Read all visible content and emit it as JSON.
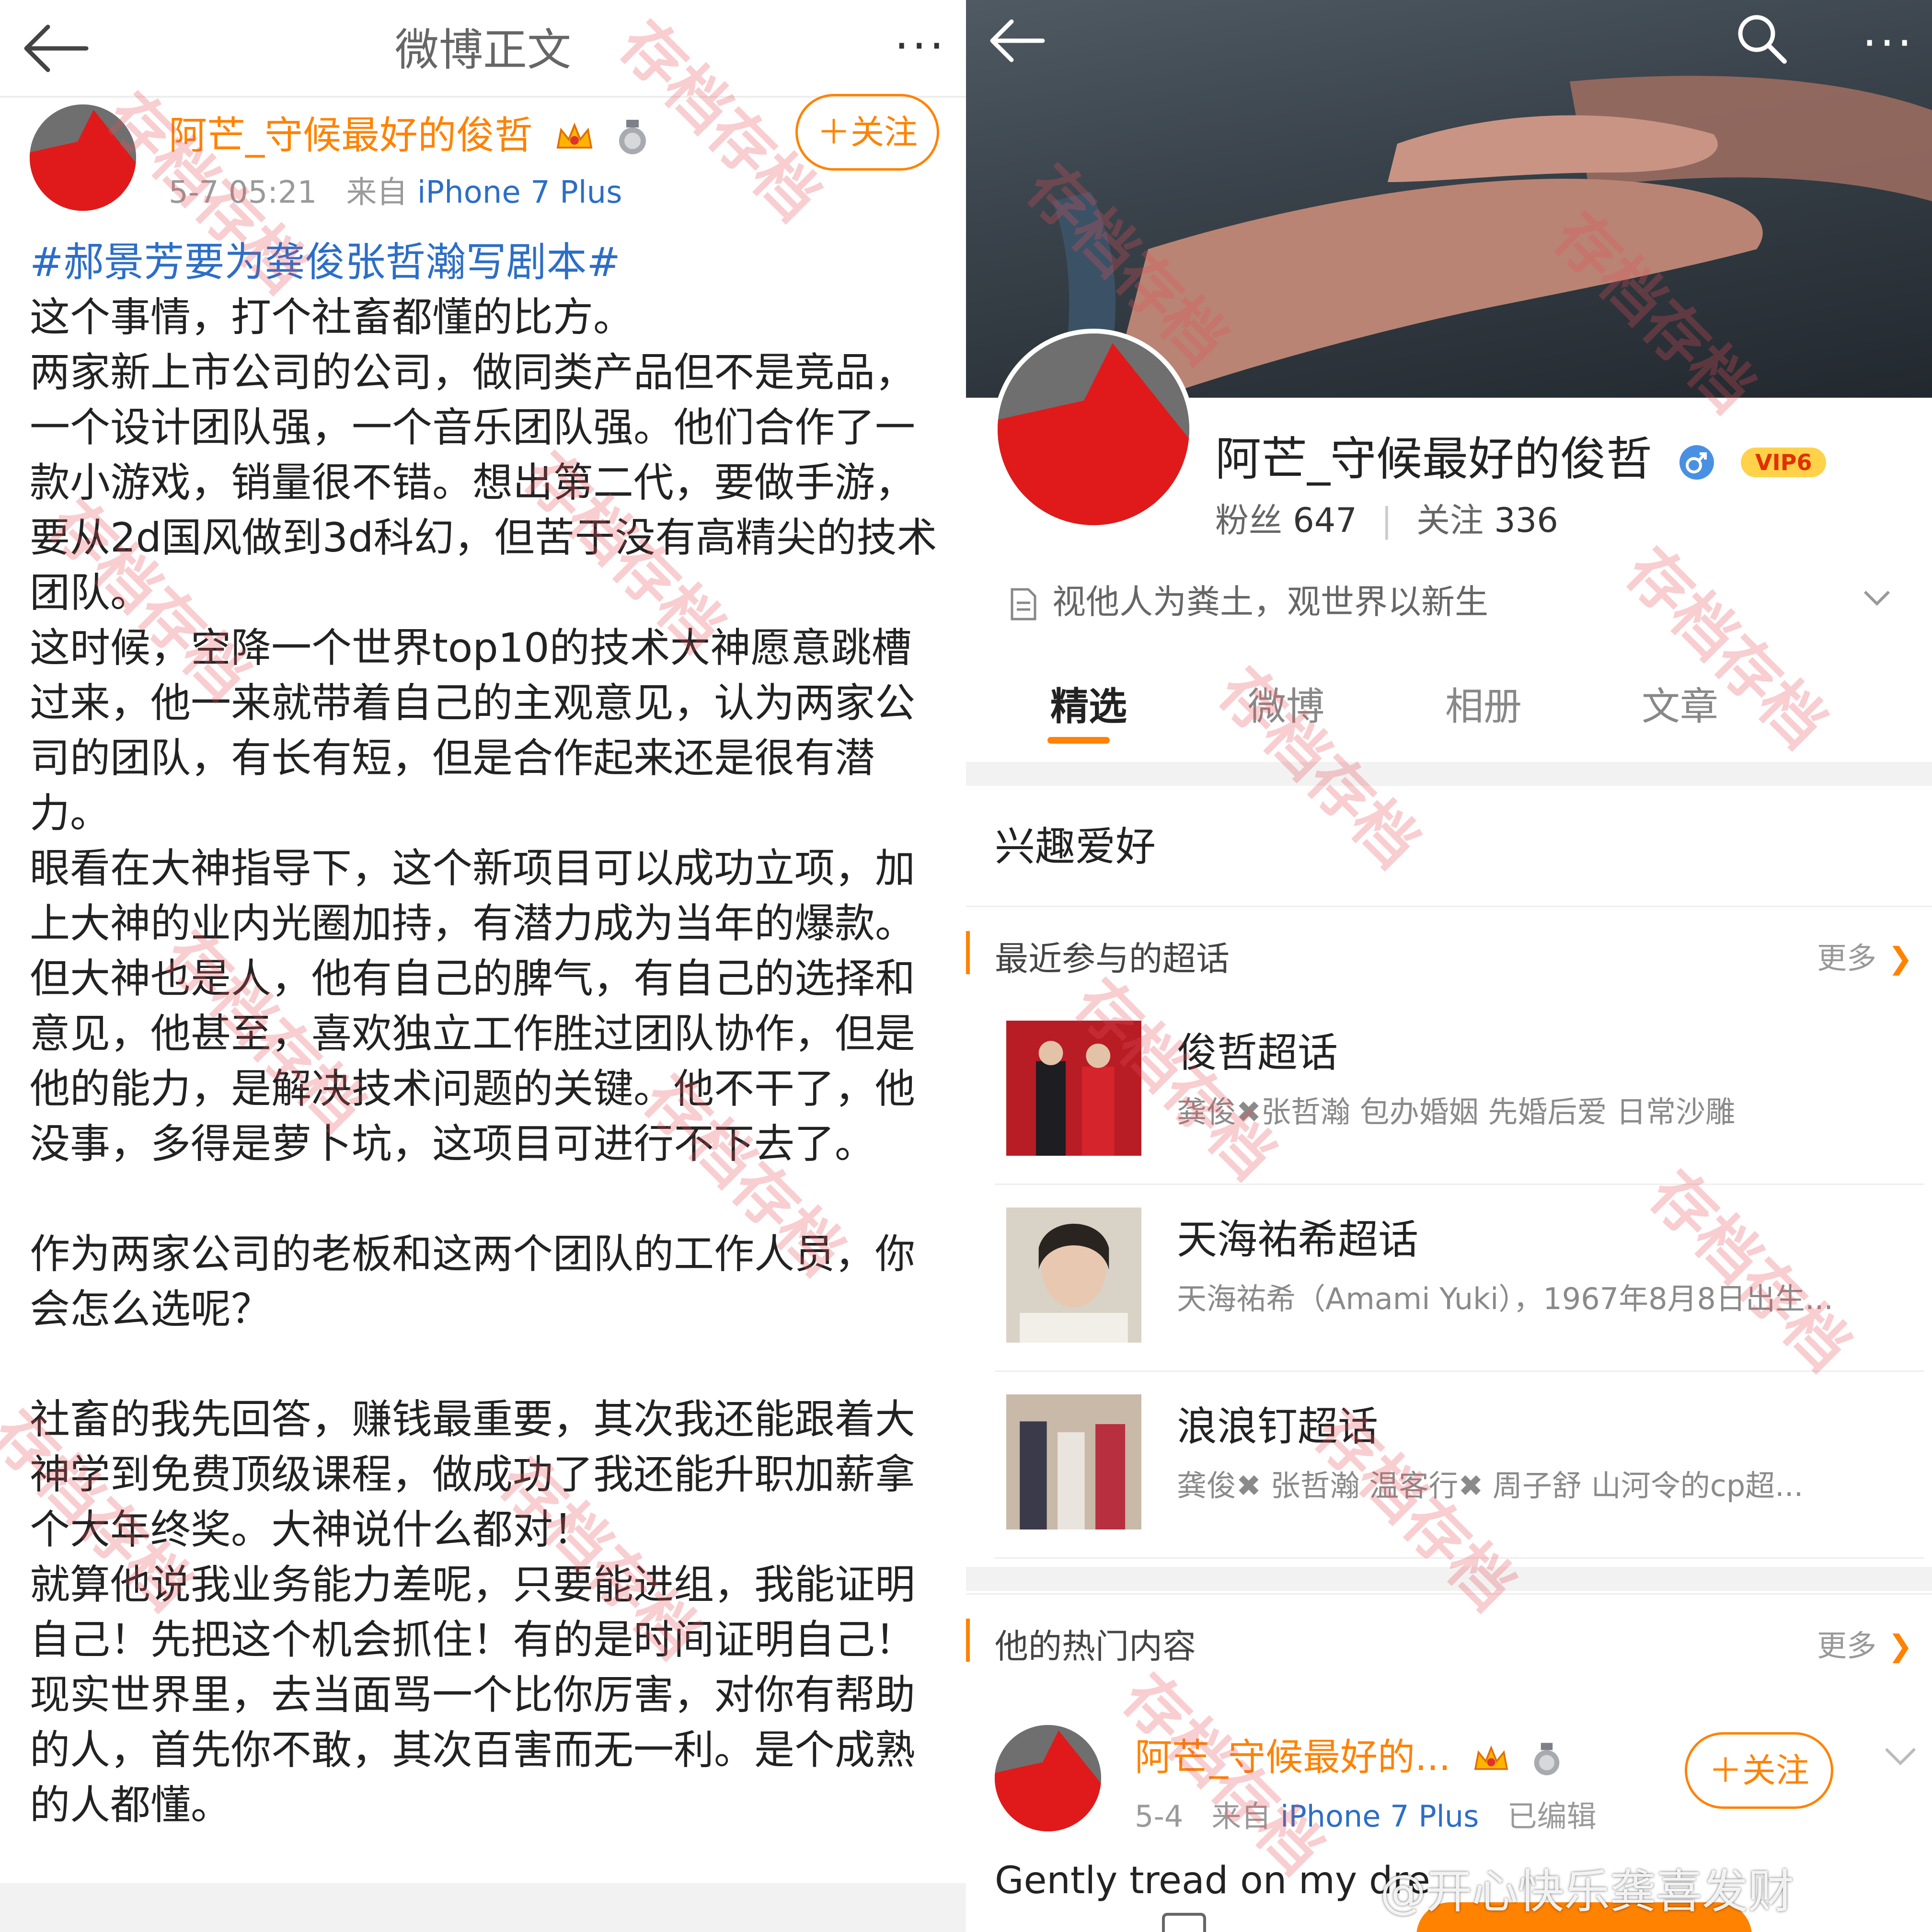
{
  "left": {
    "header_title": "微博正文",
    "more_label": "···",
    "author": {
      "name": "阿芒_守候最好的俊哲",
      "time": "5-7 05:21",
      "from_label": "来自",
      "source": "iPhone 7 Plus"
    },
    "follow_label": "＋关注",
    "hashtag": "#郝景芳要为龚俊张哲瀚写剧本#",
    "paragraphs": [
      "这个事情，打个社畜都懂的比方。",
      "两家新上市公司的公司，做同类产品但不是竞品，一个设计团队强，一个音乐团队强。他们合作了一款小游戏，销量很不错。想出第二代，要做手游，要从2d国风做到3d科幻，但苦于没有高精尖的技术团队。",
      "这时候，空降一个世界top10的技术大神愿意跳槽过来，他一来就带着自己的主观意见，认为两家公司的团队，有长有短，但是合作起来还是很有潜力。",
      "眼看在大神指导下，这个新项目可以成功立项，加上大神的业内光圈加持，有潜力成为当年的爆款。但大神也是人，他有自己的脾气，有自己的选择和意见，他甚至，喜欢独立工作胜过团队协作，但是他的能力，是解决技术问题的关键。他不干了，他没事，多得是萝卜坑，这项目可进行不下去了。",
      "",
      "作为两家公司的老板和这两个团队的工作人员，你会怎么选呢？",
      "",
      "社畜的我先回答，赚钱最重要，其次我还能跟着大神学到免费顶级课程，做成功了我还能升职加薪拿个大年终奖。大神说什么都对！",
      "就算他说我业务能力差呢，只要能进组，我能证明自己！先把这个机会抓住！有的是时间证明自己！",
      "现实世界里，去当面骂一个比你厉害，对你有帮助的人，首先你不敢，其次百害而无一利。是个成熟的人都懂。"
    ]
  },
  "right": {
    "more_label": "···",
    "profile": {
      "name": "阿芒_守候最好的俊哲",
      "vip_label": "VIP6",
      "fans_label": "粉丝",
      "fans": "647",
      "following_label": "关注",
      "following": "336",
      "bio": "视他人为粪土，观世界以新生"
    },
    "tabs": [
      "精选",
      "微博",
      "相册",
      "文章"
    ],
    "section_title": "兴趣爱好",
    "supertopics": {
      "title": "最近参与的超话",
      "more_label": "更多",
      "items": [
        {
          "name": "俊哲超话",
          "desc": "龚俊✖张哲瀚   包办婚姻 先婚后爱   日常沙雕"
        },
        {
          "name": "天海祐希超话",
          "desc": "天海祐希（Amami Yuki），1967年8月8日出生..."
        },
        {
          "name": "浪浪钉超话",
          "desc": "龚俊✖ 张哲瀚  温客行✖ 周子舒 山河令的cp超..."
        }
      ]
    },
    "hot": {
      "title": "他的热门内容",
      "more_label": "更多",
      "post": {
        "name": "阿芒_守候最好的...",
        "time": "5-4",
        "from_label": "来自",
        "source": "iPhone 7 Plus",
        "edited": "已编辑",
        "follow_label": "＋关注",
        "text": "Gently tread on my dre"
      }
    }
  },
  "watermark_text": "存档存档",
  "credit": "@开心快乐龚喜发财",
  "colors": {
    "accent": "#ff8200",
    "link": "#2c6ec7",
    "watermark": "#e6505a"
  }
}
